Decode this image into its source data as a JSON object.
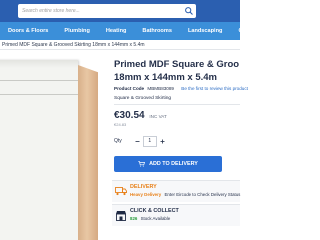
{
  "search": {
    "placeholder": "Search entire store here..."
  },
  "nav": {
    "items": [
      {
        "label": "Doors & Floors"
      },
      {
        "label": "Plumbing"
      },
      {
        "label": "Heating"
      },
      {
        "label": "Bathrooms"
      },
      {
        "label": "Landscaping"
      },
      {
        "label": "Offers"
      }
    ]
  },
  "breadcrumb": {
    "text": "Primed MDF Square & Grooved Skirting 18mm x 144mm x 5.4m"
  },
  "product": {
    "title_line1": "Primed MDF Square & Groo",
    "title_line2": "18mm x 144mm x 5.4m",
    "code_label": "Product Code",
    "code_value": "MBMB83089",
    "review_link": "Be the first to review this product",
    "subtype": "Square & Grooved Skirting",
    "price": "€30.54",
    "vat_note": "INC VAT",
    "price_ex": "€24.83",
    "qty_label": "Qty",
    "qty_value": "1",
    "add_button": "ADD TO DELIVERY"
  },
  "delivery": {
    "title": "DELIVERY",
    "status": "Heavy Delivery",
    "detail": "Enter Eircode to Check Delivery Status"
  },
  "click_collect": {
    "title": "CLICK & COLLECT",
    "status": "826",
    "detail": "Stock Available"
  },
  "colors": {
    "topbar": "#2b5fb0",
    "nav": "#3b8fd9",
    "button": "#2a6fd6",
    "delivery": "#e8811a",
    "stock": "#2a9d3e"
  }
}
